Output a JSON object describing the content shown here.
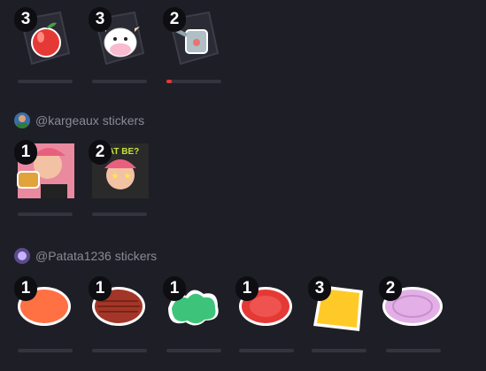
{
  "row1": [
    {
      "name": "apple",
      "count": "3",
      "progress": 0
    },
    {
      "name": "cow",
      "count": "3",
      "progress": 0
    },
    {
      "name": "watering-can",
      "count": "2",
      "progress": 0.1
    }
  ],
  "sections": [
    {
      "title": "@kargeaux stickers",
      "stickers": [
        {
          "name": "drinking-character",
          "count": "1"
        },
        {
          "name": "dat-be-character",
          "count": "2",
          "art_text": "DAT BE?"
        }
      ]
    },
    {
      "title": "@Patata1236 stickers",
      "stickers": [
        {
          "name": "orange-patty",
          "count": "1"
        },
        {
          "name": "meat-patty",
          "count": "1"
        },
        {
          "name": "lettuce",
          "count": "1"
        },
        {
          "name": "tomato-slice",
          "count": "1"
        },
        {
          "name": "cheese-slice",
          "count": "3"
        },
        {
          "name": "onion-slice",
          "count": "2"
        }
      ]
    }
  ],
  "colors": {
    "progress_accent": "#e53935",
    "bar_track": "#34343e",
    "background": "#1e1e26"
  }
}
